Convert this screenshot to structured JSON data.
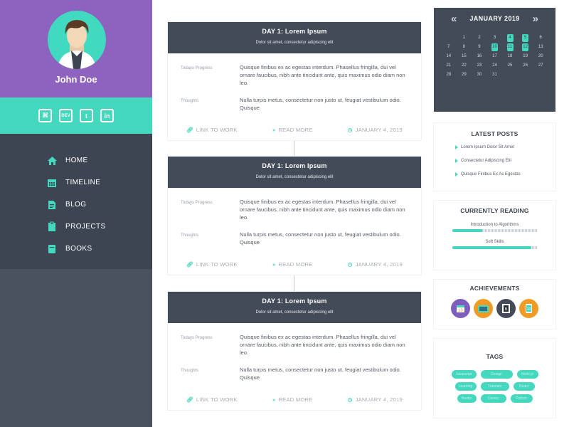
{
  "profile": {
    "name": "John Doe",
    "social": [
      {
        "icon": "github-icon",
        "glyph": "⌘"
      },
      {
        "icon": "dev-icon",
        "glyph": "DEV"
      },
      {
        "icon": "twitter-icon",
        "glyph": "t"
      },
      {
        "icon": "linkedin-icon",
        "glyph": "in"
      }
    ]
  },
  "nav": {
    "items": [
      {
        "label": "HOME",
        "icon": "home-icon"
      },
      {
        "label": "TIMELINE",
        "icon": "calendar-icon"
      },
      {
        "label": "BLOG",
        "icon": "document-icon"
      },
      {
        "label": "PROJECTS",
        "icon": "clipboard-icon"
      },
      {
        "label": "BOOKS",
        "icon": "book-icon"
      }
    ]
  },
  "timeline": {
    "cards": [
      {
        "title": "DAY 1:  Lorem Ipsum",
        "subtitle": "Dolor sit amet, consectetur adipiscing elit",
        "progress_label": "Todays Progress",
        "progress_text": "Quisque finibus ex ac egestas interdum. Phasellus fringilla, dui vel ornare faucibus, nibh ante tincidunt ante, quis maximus odio diam non leo.",
        "thoughts_label": "Thoughts",
        "thoughts_text": "Nulla turpis metus, consectetur non justo ut, feugiat vestibulum odio. Quisque",
        "link_label": "LINK TO WORK",
        "read_label": "READ MORE",
        "date": "JANUARY 4, 2019"
      },
      {
        "title": "DAY 1:  Lorem Ipsum",
        "subtitle": "Dolor sit amet, consectetur adipiscing elit",
        "progress_label": "Todays Progress",
        "progress_text": "Quisque finibus ex ac egestas interdum. Phasellus fringilla, dui vel ornare faucibus, nibh ante tincidunt ante, quis maximus odio diam non leo.",
        "thoughts_label": "Thoughts",
        "thoughts_text": "Nulla turpis metus, consectetur non justo ut, feugiat vestibulum odio. Quisque",
        "link_label": "LINK TO WORK",
        "read_label": "READ MORE",
        "date": "JANUARY 4, 2019"
      },
      {
        "title": "DAY 1:  Lorem Ipsum",
        "subtitle": "Dolor sit amet, consectetur adipiscing elit",
        "progress_label": "Todays Progress",
        "progress_text": "Quisque finibus ex ac egestas interdum. Phasellus fringilla, dui vel ornare faucibus, nibh ante tincidunt ante, quis maximus odio diam non leo.",
        "thoughts_label": "Thoughts",
        "thoughts_text": "Nulla turpis metus, consectetur non justo ut, feugiat vestibulum odio. Quisque",
        "link_label": "LINK TO WORK",
        "read_label": "READ MORE",
        "date": "JANUARY 4, 2019"
      }
    ]
  },
  "calendar": {
    "month": "JANUARY 2019",
    "prev_icon": "double-chevron-left-icon",
    "next_icon": "double-chevron-right-icon",
    "days": [
      {
        "d": "",
        "mark": false
      },
      {
        "d": "1",
        "mark": false
      },
      {
        "d": "2",
        "mark": false
      },
      {
        "d": "3",
        "mark": false
      },
      {
        "d": "4",
        "mark": true
      },
      {
        "d": "5",
        "mark": true
      },
      {
        "d": "6",
        "mark": false
      },
      {
        "d": "7",
        "mark": false
      },
      {
        "d": "8",
        "mark": false
      },
      {
        "d": "9",
        "mark": false
      },
      {
        "d": "10",
        "mark": true
      },
      {
        "d": "11",
        "mark": true
      },
      {
        "d": "12",
        "mark": true
      },
      {
        "d": "13",
        "mark": false
      },
      {
        "d": "14",
        "mark": false
      },
      {
        "d": "15",
        "mark": false
      },
      {
        "d": "16",
        "mark": false
      },
      {
        "d": "17",
        "mark": false
      },
      {
        "d": "18",
        "mark": false
      },
      {
        "d": "19",
        "mark": false
      },
      {
        "d": "20",
        "mark": false
      },
      {
        "d": "21",
        "mark": false
      },
      {
        "d": "22",
        "mark": false
      },
      {
        "d": "23",
        "mark": false
      },
      {
        "d": "24",
        "mark": false
      },
      {
        "d": "25",
        "mark": false
      },
      {
        "d": "26",
        "mark": false
      },
      {
        "d": "27",
        "mark": false
      },
      {
        "d": "28",
        "mark": false
      },
      {
        "d": "29",
        "mark": false
      },
      {
        "d": "30",
        "mark": false
      },
      {
        "d": "31",
        "mark": false
      },
      {
        "d": "",
        "mark": false
      },
      {
        "d": "",
        "mark": false
      },
      {
        "d": "",
        "mark": false
      }
    ]
  },
  "latest_posts": {
    "title": "LATEST POSTS",
    "items": [
      "Lorem Ipsum Dolor Sit Amet",
      "Consectetur Adipiscing Elit",
      "Quisque Finibus Ex Ac Egestas"
    ]
  },
  "reading": {
    "title": "CURRENTLY READING",
    "books": [
      {
        "title": "Introduction to Algorithms",
        "progress": 0.35
      },
      {
        "title": "Soft Skills",
        "progress": 0.93
      }
    ]
  },
  "achievements": {
    "title": "ACHIEVEMENTS",
    "badges": [
      {
        "icon": "calendar-badge-icon",
        "color": "#7e5dbd"
      },
      {
        "icon": "ticket-badge-icon",
        "color": "#f29b24"
      },
      {
        "icon": "book-badge-icon",
        "color": "#444b58"
      },
      {
        "icon": "tablet-badge-icon",
        "color": "#f29b24"
      }
    ]
  },
  "tags": {
    "title": "TAGS",
    "items": [
      "Javascript",
      "Design",
      "Node.js",
      "Learning",
      "Tutorials",
      "React",
      "Books",
      "Career",
      "Python"
    ]
  },
  "colors": {
    "accent": "#44d8bf",
    "purple": "#8e63c0",
    "dark": "#444b58"
  }
}
